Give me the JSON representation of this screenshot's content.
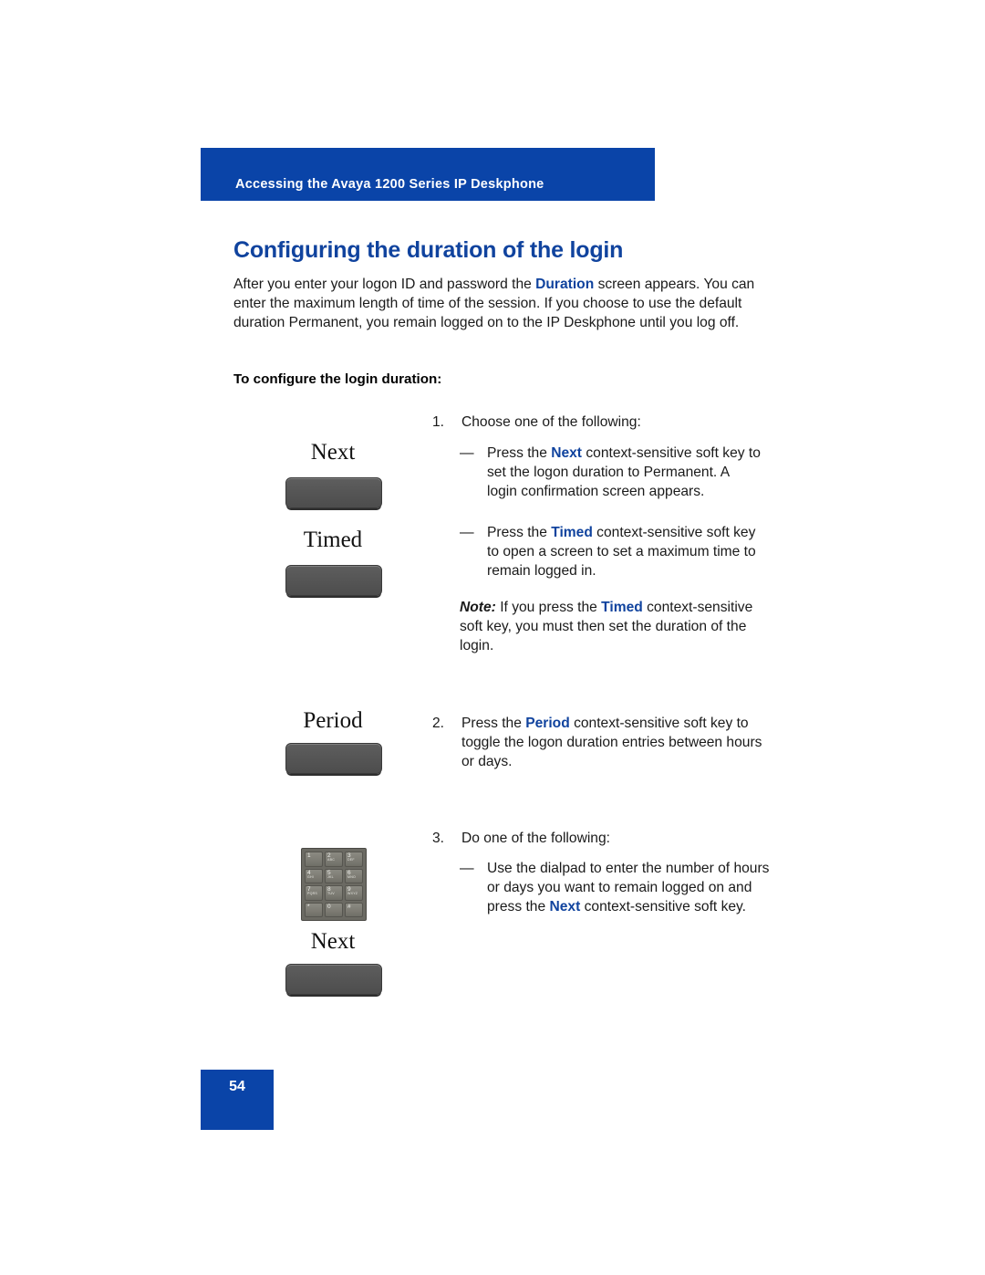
{
  "header": {
    "running_title": "Accessing the Avaya 1200 Series IP Deskphone",
    "bar_color": "#0A44A8"
  },
  "page_title": "Configuring the duration of the login",
  "title_color": "#10439E",
  "intro": {
    "part1": "After you enter your logon ID and password the ",
    "emph1": "Duration",
    "part2": " screen appears. You can enter the maximum length of time of the session. If you choose to use the default duration Permanent, you remain logged on to the IP Deskphone until you log off."
  },
  "subhead": "To configure the login duration:",
  "steps": [
    {
      "number": "1.",
      "text": "Choose one of the following:"
    },
    {
      "number": "2.",
      "text_part1": "Press the ",
      "emph": "Period",
      "text_part2": " context-sensitive soft key to toggle the logon duration entries between hours or days."
    },
    {
      "number": "3.",
      "text": "Do one of the following:"
    }
  ],
  "bullets": {
    "next_bullet": {
      "dash": "—",
      "part1": "Press the ",
      "emph": "Next",
      "part2": " context-sensitive soft key to set the logon duration to Permanent. A login confirmation screen appears."
    },
    "timed_bullet": {
      "dash": "—",
      "part1": "Press the ",
      "emph": "Timed",
      "part2": " context-sensitive soft key to open a screen to set a maximum time to remain logged in."
    },
    "dialpad_bullet": {
      "dash": "—",
      "part1": "Use the dialpad to enter the number of hours or days you want to remain logged on and press the ",
      "emph": "Next",
      "part2": " context-sensitive soft key."
    }
  },
  "note": {
    "label": "Note:",
    "part1": " If you press the ",
    "emph": "Timed",
    "part2": " context-sensitive soft key, you must then set the duration of the login."
  },
  "softkeys": [
    {
      "label": "Next"
    },
    {
      "label": "Timed"
    },
    {
      "label": "Period"
    },
    {
      "label": "Next"
    }
  ],
  "dialpad": {
    "keys": [
      {
        "digit": "1",
        "letters": ""
      },
      {
        "digit": "2",
        "letters": "ABC"
      },
      {
        "digit": "3",
        "letters": "DEF"
      },
      {
        "digit": "4",
        "letters": "GHI"
      },
      {
        "digit": "5",
        "letters": "JKL"
      },
      {
        "digit": "6",
        "letters": "MNO"
      },
      {
        "digit": "7",
        "letters": "PQRS"
      },
      {
        "digit": "8",
        "letters": "TUV"
      },
      {
        "digit": "9",
        "letters": "WXYZ"
      },
      {
        "digit": "*",
        "letters": ""
      },
      {
        "digit": "0",
        "letters": ""
      },
      {
        "digit": "#",
        "letters": ""
      }
    ]
  },
  "page_number": "54"
}
